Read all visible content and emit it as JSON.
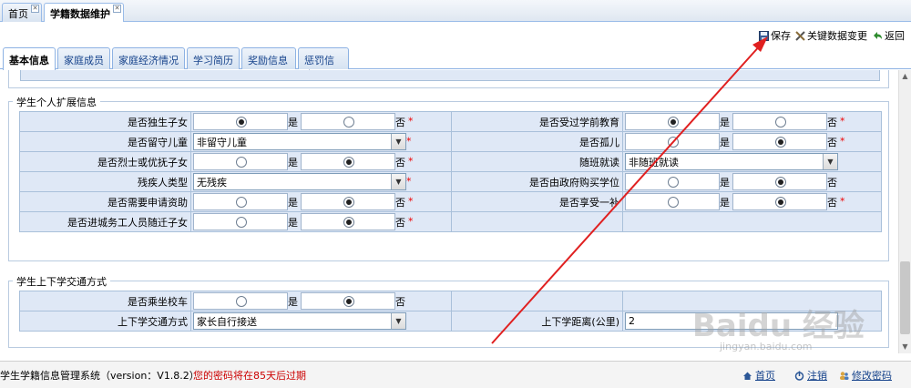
{
  "top_tabs": [
    {
      "label": "首页"
    },
    {
      "label": "学籍数据维护"
    }
  ],
  "toolbar": {
    "save_label": "保存",
    "key_change_label": "关键数据变更",
    "back_label": "返回"
  },
  "content_tabs": [
    {
      "label": "基本信息"
    },
    {
      "label": "家庭成员"
    },
    {
      "label": "家庭经济情况"
    },
    {
      "label": "学习简历"
    },
    {
      "label": "奖励信息"
    },
    {
      "label": "惩罚信息"
    }
  ],
  "ext_section": {
    "legend": "学生个人扩展信息",
    "yes": "是",
    "no": "否",
    "required_mark": "*",
    "left": [
      {
        "label": "是否独生子女",
        "type": "radio",
        "selected": "yes",
        "required": true
      },
      {
        "label": "是否留守儿童",
        "type": "select",
        "value": "非留守儿童",
        "required": true
      },
      {
        "label": "是否烈士或优抚子女",
        "type": "radio",
        "selected": "no",
        "required": true
      },
      {
        "label": "残疾人类型",
        "type": "select",
        "value": "无残疾",
        "required": true
      },
      {
        "label": "是否需要申请资助",
        "type": "radio",
        "selected": "no",
        "required": true
      },
      {
        "label": "是否进城务工人员随迁子女",
        "type": "radio",
        "selected": "no",
        "required": true
      }
    ],
    "right": [
      {
        "label": "是否受过学前教育",
        "type": "radio",
        "selected": "yes",
        "required": true
      },
      {
        "label": "是否孤儿",
        "type": "radio",
        "selected": "no",
        "required": true
      },
      {
        "label": "随班就读",
        "type": "select",
        "value": "非随班就读",
        "required": false
      },
      {
        "label": "是否由政府购买学位",
        "type": "radio",
        "selected": "no",
        "required": false
      },
      {
        "label": "是否享受一补",
        "type": "radio",
        "selected": "no",
        "required": true
      }
    ]
  },
  "transport_section": {
    "legend": "学生上下学交通方式",
    "bus_label": "是否乘坐校车",
    "bus_selected": "no",
    "mode_label": "上下学交通方式",
    "mode_value": "家长自行接送",
    "distance_label": "上下学距离(公里)",
    "distance_value": "2"
  },
  "status_bar": {
    "system_name": "学生学籍信息管理系统（version：V1.8.2）",
    "password_notice": "您的密码将在85天后过期",
    "home_label": "首页",
    "logout_label": "注销",
    "change_password_label": "修改密码"
  },
  "watermark": {
    "text": "Baidu 经验",
    "url": "jingyan.baidu.com"
  },
  "colors": {
    "label_bg": "#dfe8f6",
    "border": "#a9c0da",
    "required": "#ee0000",
    "notice": "#cc0000",
    "arrow": "#e02020"
  }
}
